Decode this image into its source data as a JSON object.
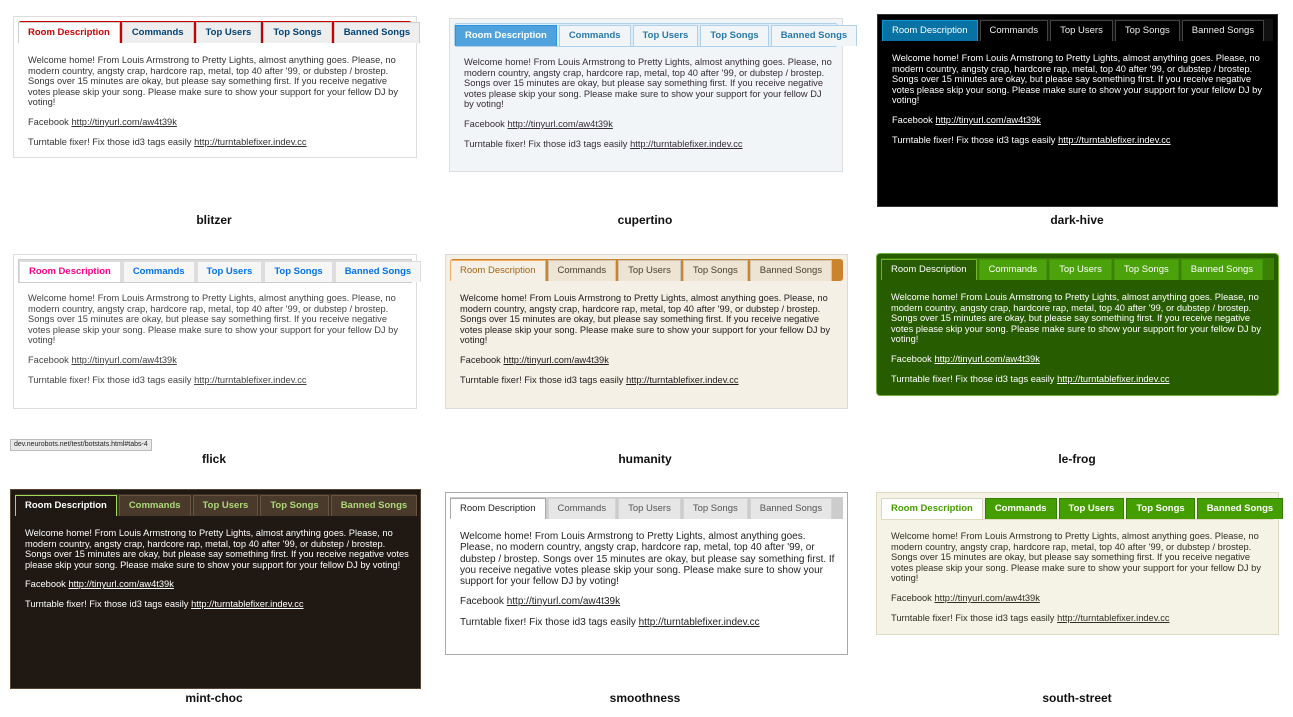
{
  "tabs": [
    "Room Description",
    "Commands",
    "Top Users",
    "Top Songs",
    "Banned Songs"
  ],
  "content": {
    "welcome": "Welcome home! From Louis Armstrong to Pretty Lights, almost anything goes. Please, no modern country, angsty crap, hardcore rap, metal, top 40 after '99, or dubstep / brostep. Songs over 15 minutes are okay, but please say something first. If you receive negative votes please skip your song. Please make sure to show your support for your fellow DJ by voting!",
    "facebook_label": "Facebook",
    "facebook_link": "http://tinyurl.com/aw4t39k",
    "fixer_label": "Turntable fixer! Fix those id3 tags easily",
    "fixer_link": "http://turntablefixer.indev.cc"
  },
  "themes": [
    {
      "name": "blitzer",
      "accent": "#cc0000"
    },
    {
      "name": "cupertino",
      "accent": "#4fa2dc"
    },
    {
      "name": "dark-hive",
      "accent": "#0972a5"
    },
    {
      "name": "flick",
      "accent": "#ff0084"
    },
    {
      "name": "humanity",
      "accent": "#cb842e"
    },
    {
      "name": "le-frog",
      "accent": "#3a8104"
    },
    {
      "name": "mint-choc",
      "accent": "#add978"
    },
    {
      "name": "smoothness",
      "accent": "#cccccc"
    },
    {
      "name": "south-street",
      "accent": "#459e00"
    }
  ],
  "status_bar": "dev.neurobots.net/test/botstats.html#tabs-4"
}
